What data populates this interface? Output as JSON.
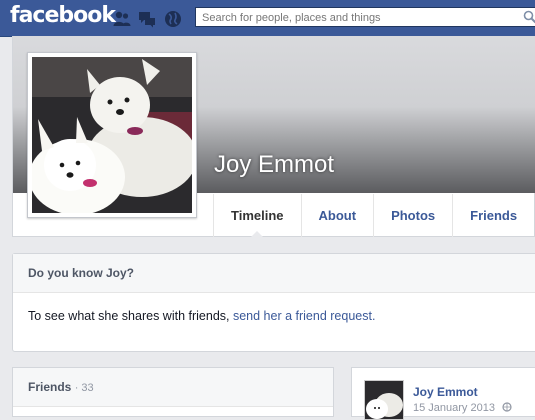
{
  "header": {
    "logo_text": "facebook",
    "search_placeholder": "Search for people, places and things",
    "jewels": [
      "friend-requests-icon",
      "messages-icon",
      "notifications-icon"
    ]
  },
  "profile": {
    "name": "Joy Emmot",
    "tabs": [
      {
        "label": "Timeline",
        "active": true
      },
      {
        "label": "About"
      },
      {
        "label": "Photos"
      },
      {
        "label": "Friends"
      }
    ]
  },
  "know_card": {
    "title": "Do you know Joy?",
    "text": "To see what she shares with friends, ",
    "link": "send her a friend request."
  },
  "friends_card": {
    "title": "Friends",
    "count": "· 33"
  },
  "post": {
    "author": "Joy Emmot",
    "date": "15 January 2013"
  },
  "colors": {
    "brand_blue": "#3b5998",
    "page_bg": "#e9eaed"
  }
}
